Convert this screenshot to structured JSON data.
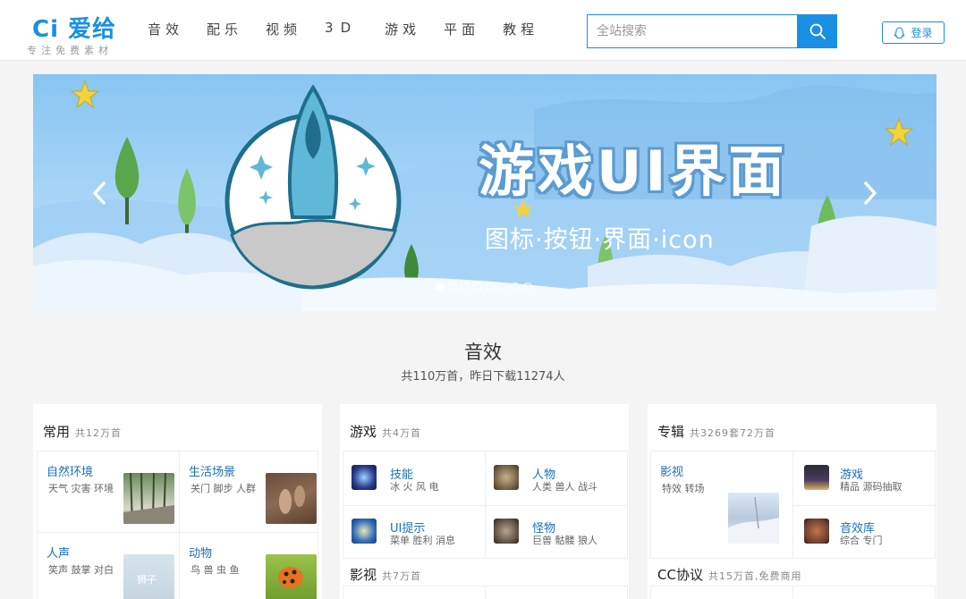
{
  "header": {
    "logo_text": "Ci 爱给",
    "logo_sub": "专注免费素材",
    "nav": [
      "音效",
      "配乐",
      "视频",
      "3D",
      "游戏",
      "平面",
      "教程"
    ],
    "search_placeholder": "全站搜索",
    "login_label": "登录"
  },
  "banner": {
    "title": "游戏UI界面",
    "subtitle": "图标·按钮·界面·icon",
    "slides": 8,
    "active_slide": 1
  },
  "section": {
    "title": "音效",
    "subtitle": "共110万首，昨日下载11274人"
  },
  "cards": {
    "common": {
      "title": "常用",
      "count": "共12万首",
      "items": [
        {
          "name": "自然环境",
          "tags": "天气 灾害 环境"
        },
        {
          "name": "生活场景",
          "tags": "关门 脚步 人群"
        },
        {
          "name": "人声",
          "tags": "笑声 鼓掌 对白"
        },
        {
          "name": "动物",
          "tags": "鸟 兽 虫 鱼"
        }
      ],
      "thumb_text": "狮子"
    },
    "game": {
      "title": "游戏",
      "count": "共4万首",
      "items": [
        {
          "name": "技能",
          "tags": "冰 火 风 电"
        },
        {
          "name": "人物",
          "tags": "人类 兽人 战斗"
        },
        {
          "name": "UI提示",
          "tags": "菜单 胜利 消息"
        },
        {
          "name": "怪物",
          "tags": "巨兽 骷髅 狼人"
        }
      ],
      "sub_title": "影视",
      "sub_count": "共7万首"
    },
    "album": {
      "title": "专辑",
      "count": "共3269套72万首",
      "items": [
        {
          "name": "影视",
          "tags": "特效 转场"
        },
        {
          "name": "游戏",
          "tags": "精品 源码抽取"
        },
        {
          "name": "音效库",
          "tags": "综合 专门"
        }
      ],
      "sub_title": "CC协议",
      "sub_count": "共15万首,免费商用"
    }
  },
  "colors": {
    "accent": "#1a8fe3",
    "link": "#1a6fb8",
    "banner_sky": "#88c5f2"
  }
}
